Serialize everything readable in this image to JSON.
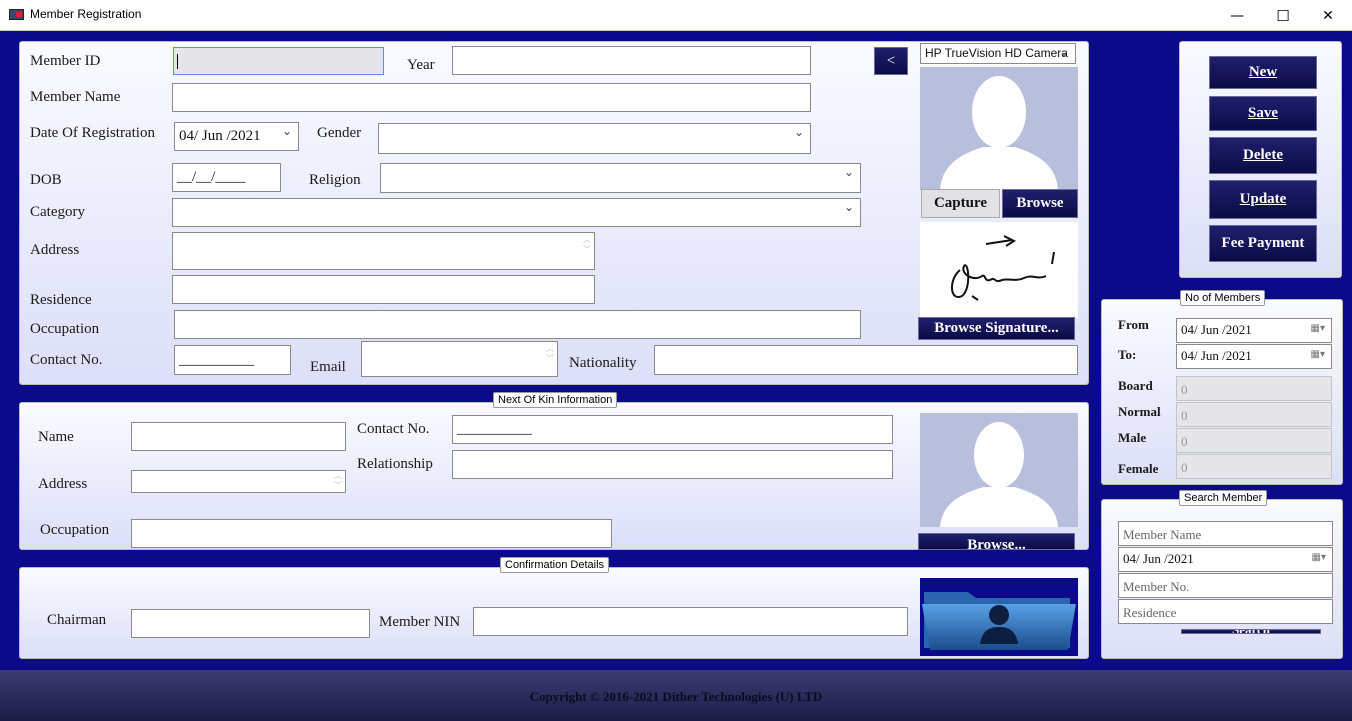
{
  "window": {
    "title": "Member Registration",
    "min": "—",
    "max": "☐",
    "close": "✕"
  },
  "form": {
    "member_id": "Member ID",
    "year": "Year",
    "member_name": "Member Name",
    "date_of_registration": "Date Of Registration",
    "date_value": "04/ Jun /2021",
    "gender": "Gender",
    "dob": "DOB",
    "dob_mask": "__/__/____",
    "religion": "Religion",
    "category": "Category",
    "address": "Address",
    "residence": "Residence",
    "occupation": "Occupation",
    "contact_no": "Contact No.",
    "contact_mask": "__________",
    "email": "Email",
    "nationality": "Nationality",
    "back": "<"
  },
  "camera": {
    "device": "HP TrueVision HD Camera",
    "capture": "Capture",
    "browse": "Browse",
    "browse_signature": "Browse Signature..."
  },
  "actions": {
    "new": "New",
    "save": "Save",
    "delete": "Delete",
    "update": "Update",
    "fee_payment": "Fee Payment"
  },
  "stats": {
    "caption": "No of Members",
    "from": "From",
    "to": "To:",
    "from_value": "04/ Jun /2021",
    "to_value": "04/ Jun /2021",
    "board": "Board",
    "normal": "Normal",
    "male": "Male",
    "female": "Female",
    "board_value": "0",
    "normal_value": "0",
    "male_value": "0",
    "female_value": "0"
  },
  "kin": {
    "caption": "Next Of Kin Information",
    "name": "Name",
    "address": "Address",
    "occupation": "Occupation",
    "contact_no": "Contact No.",
    "contact_mask": "__________",
    "relationship": "Relationship",
    "browse": "Browse..."
  },
  "confirm": {
    "caption": "Confirmation Details",
    "chairman": "Chairman",
    "member_nin": "Member NIN"
  },
  "search": {
    "caption": "Search Member",
    "name_ph": "Member Name",
    "date_value": "04/ Jun /2021",
    "number_ph": "Member No.",
    "residence_ph": "Residence",
    "button": "Search"
  },
  "footer": "Copyright ©  2016-2021 Dither Technologies (U) LTD"
}
